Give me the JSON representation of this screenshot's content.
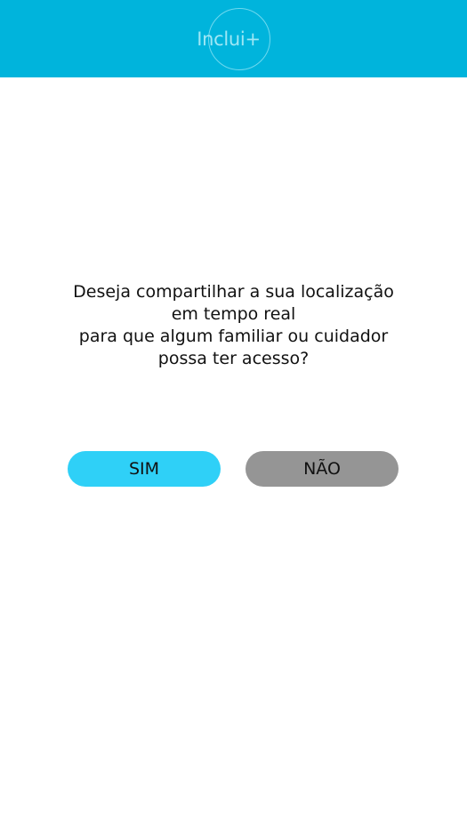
{
  "header": {
    "logo_text": "Inclui+",
    "background_color": "#00b4dc"
  },
  "prompt": {
    "lines": [
      "Deseja compartilhar a sua localização",
      "em tempo real",
      "para que algum familiar ou cuidador",
      "possa ter acesso?"
    ]
  },
  "actions": {
    "yes_label": "SIM",
    "yes_color": "#2fd0f7",
    "no_label": "NÃO",
    "no_color": "#959595"
  }
}
